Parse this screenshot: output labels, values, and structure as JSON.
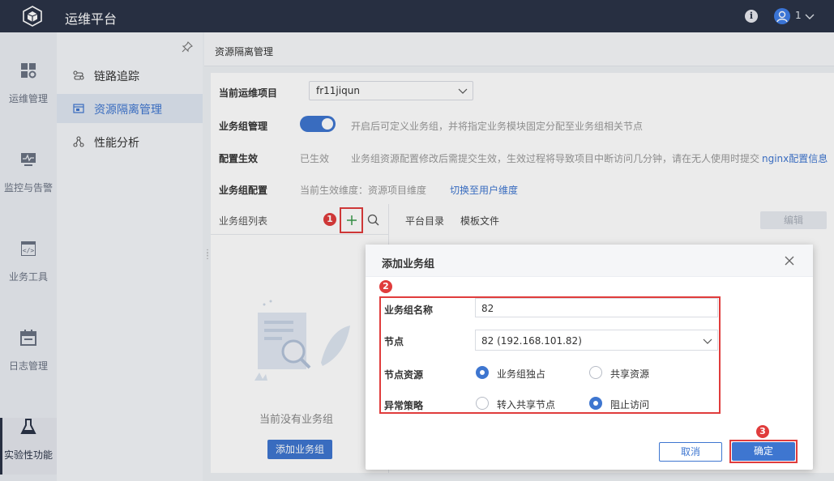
{
  "topbar": {
    "title": "运维平台",
    "user": "1"
  },
  "rail": [
    {
      "label": "运维管理",
      "icon": "grid-settings-icon"
    },
    {
      "label": "监控与告警",
      "icon": "monitor-icon"
    },
    {
      "label": "业务工具",
      "icon": "code-icon"
    },
    {
      "label": "日志管理",
      "icon": "calendar-icon"
    },
    {
      "label": "实验性功能",
      "icon": "flask-icon"
    }
  ],
  "subnav": [
    {
      "label": "链路追踪",
      "icon": "link-icon"
    },
    {
      "label": "资源隔离管理",
      "icon": "resource-icon"
    },
    {
      "label": "性能分析",
      "icon": "nodes-icon"
    }
  ],
  "page": {
    "title": "资源隔离管理",
    "project_label": "当前运维项目",
    "project_value": "fr11jiqun",
    "group_mgmt_label": "业务组管理",
    "group_mgmt_desc": "开启后可定义业务组，并将指定业务模块固定分配至业务组相关节点",
    "config_effect_label": "配置生效",
    "config_effect_status": "已生效",
    "config_effect_desc": "业务组资源配置修改后需提交生效，生效过程将导致项目中断访问几分钟，请在无人使用时提交",
    "config_effect_link": "nginx配置信息",
    "group_config_label": "业务组配置",
    "group_config_desc": "当前生效维度：资源项目维度",
    "group_config_link": "切换至用户维度",
    "list_title": "业务组列表",
    "tab_platform": "平台目录",
    "tab_template": "模板文件",
    "edit_button": "编辑",
    "empty_text": "当前没有业务组",
    "add_group_button": "添加业务组"
  },
  "badges": [
    "1",
    "2",
    "3"
  ],
  "dialog": {
    "title": "添加业务组",
    "name_label": "业务组名称",
    "name_value": "82",
    "node_label": "节点",
    "node_value": "82 (192.168.101.82)",
    "resource_label": "节点资源",
    "resource_opt1": "业务组独占",
    "resource_opt2": "共享资源",
    "policy_label": "异常策略",
    "policy_opt1": "转入共享节点",
    "policy_opt2": "阻止访问",
    "cancel": "取消",
    "confirm": "确定"
  },
  "colors": {
    "accent": "#3e76d0",
    "topbar": "#2b3447",
    "highlight": "#e03c3c"
  }
}
